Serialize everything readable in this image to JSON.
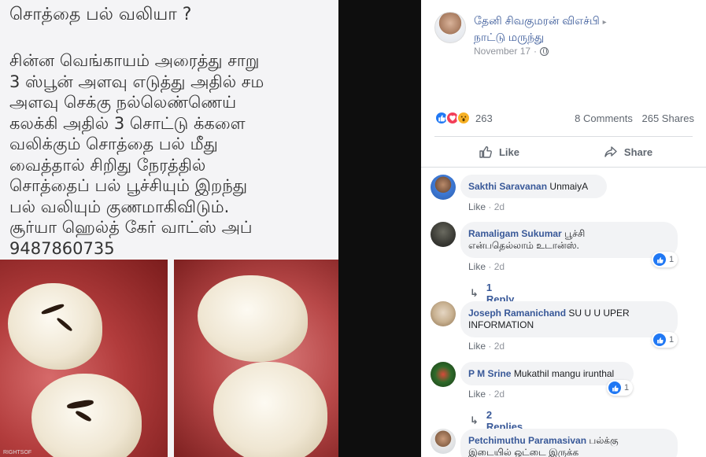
{
  "photo": {
    "title": "சொத்தை பல் வலியா ?",
    "body_lines": [
      "சின்ன வெங்காயம் அரைத்து சாறு",
      "3 ஸ்பூன் அளவு எடுத்து அதில் சம",
      "அளவு செக்கு நல்லெண்ணெய்",
      "கலக்கி அதில் 3 சொட்டு க்களை",
      "வலிக்கும் சொத்தை பல் மீது",
      "வைத்தால் சிறிது நேரத்தில்",
      "சொத்தைப் பல் பூச்சியும் இறந்து",
      "பல் வலியும் குணமாகிவிடும்.",
      "சூர்யா ஹெல்த் கேர் வாட்ஸ் அப்",
      "9487860735"
    ],
    "watermark": "RIGHTSOF"
  },
  "post": {
    "author": "தேனி சிவகுமரன் விஎச்பி",
    "author_arrow": "▸",
    "author_line2": "நாட்டு மருந்து",
    "date": "November 17",
    "dot": "·",
    "reaction_count": "263",
    "comments": "8 Comments",
    "shares": "265 Shares",
    "like_label": "Like",
    "share_label": "Share"
  },
  "comments": [
    {
      "name": "Sakthi Saravanan",
      "text": "UnmaiyA",
      "like": "Like",
      "time": "2d"
    },
    {
      "name": "Ramaligam Sukumar",
      "text_line1": "பூச்சி",
      "text_line2": "என்பதெல்லாம் உடான்ஸ்.",
      "like": "Like",
      "time": "2d",
      "reactions": "1",
      "replies": "1 Reply"
    },
    {
      "name": "Joseph Ramanichand",
      "text_line1": "SU U U UPER",
      "text_line2": "INFORMATION",
      "like": "Like",
      "time": "2d",
      "reactions": "1"
    },
    {
      "name": "P M Srine",
      "text": "Mukathil mangu irunthal",
      "like": "Like",
      "time": "2d",
      "reactions": "1",
      "replies": "2 Replies"
    },
    {
      "name": "Petchimuthu Paramasivan",
      "text_line1": "பல்க்கு",
      "text_line2": "இடையில் ஒட்டை இருக்க"
    }
  ],
  "colors": {
    "link": "#385898",
    "like_blue": "#2078f4",
    "love_red": "#f33e58",
    "wow_yellow": "#f7b125",
    "bubble_bg": "#f2f3f5"
  },
  "icons": {
    "globe": "globe-icon",
    "like": "thumbs-up-icon",
    "share": "share-arrow-icon",
    "reply": "reply-arrow-icon"
  }
}
